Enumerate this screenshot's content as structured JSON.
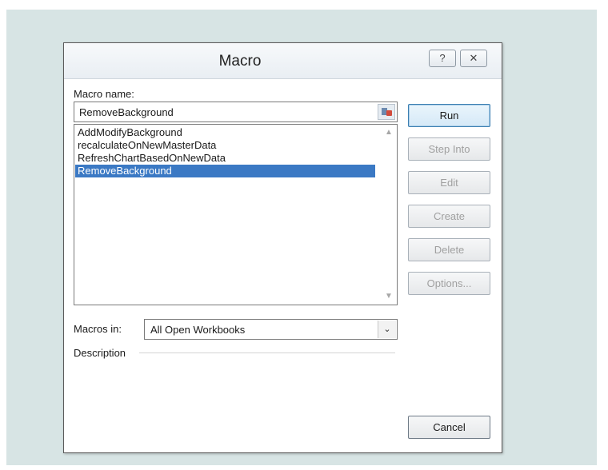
{
  "dialog": {
    "title": "Macro",
    "help_glyph": "?",
    "close_glyph": "✕"
  },
  "macro_name": {
    "label": "Macro name:",
    "value": "RemoveBackground"
  },
  "macros": [
    "AddModifyBackground",
    "recalculateOnNewMasterData",
    "RefreshChartBasedOnNewData",
    "RemoveBackground"
  ],
  "selected_macro_index": 3,
  "buttons": {
    "run": "Run",
    "step_into": "Step Into",
    "edit": "Edit",
    "create": "Create",
    "delete": "Delete",
    "options": "Options...",
    "cancel": "Cancel"
  },
  "macros_in": {
    "label": "Macros in:",
    "value": "All Open Workbooks"
  },
  "description": {
    "label": "Description"
  },
  "colors": {
    "backdrop": "#d7e4e4",
    "selection": "#3b79c4",
    "disabled_text": "#a0a0a0"
  }
}
